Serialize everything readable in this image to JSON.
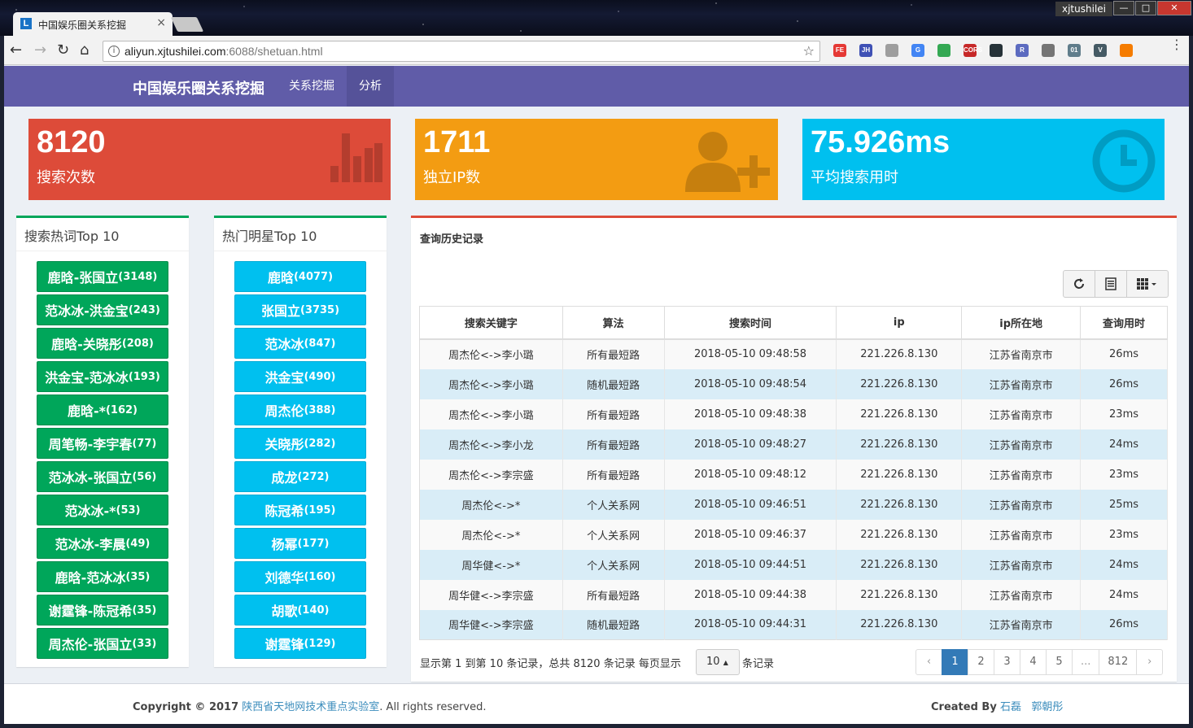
{
  "browser": {
    "tab_title": "中国娱乐圈关系挖掘",
    "tab_favicon": "L",
    "tab_close": "×",
    "url_main": "aliyun.xjtushilei.com",
    "url_rest": ":6088/shetuan.html",
    "window_user": "xjtushilei",
    "extensions": [
      {
        "label": "FE",
        "color": "#e53935"
      },
      {
        "label": "JH",
        "color": "#3f51b5"
      },
      {
        "label": "",
        "color": "#9e9e9e"
      },
      {
        "label": "G",
        "color": "#4285f4"
      },
      {
        "label": "",
        "color": "#34a853"
      },
      {
        "label": "CORS",
        "color": "#c62828"
      },
      {
        "label": "",
        "color": "#263238"
      },
      {
        "label": "R",
        "color": "#5c6bc0"
      },
      {
        "label": "",
        "color": "#757575"
      },
      {
        "label": "01",
        "color": "#607d8b"
      },
      {
        "label": "V",
        "color": "#455a64"
      },
      {
        "label": "",
        "color": "#f57c00"
      }
    ]
  },
  "nav": {
    "brand": "中国娱乐圈关系挖掘",
    "links": [
      "关系挖掘",
      "分析"
    ]
  },
  "stats": [
    {
      "value": "8120",
      "label": "搜索次数",
      "color": "#dd4b39",
      "icon": "bar-chart-icon"
    },
    {
      "value": "1711",
      "label": "独立IP数",
      "color": "#f39c12",
      "icon": "user-plus-icon"
    },
    {
      "value": "75.926ms",
      "label": "平均搜索用时",
      "color": "#00c0ef",
      "icon": "clock-icon"
    }
  ],
  "hot_keywords": {
    "title": "搜索热词Top 10",
    "items": [
      {
        "name": "鹿晗-张国立",
        "count": "(3148)"
      },
      {
        "name": "范冰冰-洪金宝",
        "count": "(243)"
      },
      {
        "name": "鹿晗-关晓彤",
        "count": "(208)"
      },
      {
        "name": "洪金宝-范冰冰",
        "count": "(193)"
      },
      {
        "name": "鹿晗-*",
        "count": "(162)"
      },
      {
        "name": "周笔畅-李宇春",
        "count": "(77)"
      },
      {
        "name": "范冰冰-张国立",
        "count": "(56)"
      },
      {
        "name": "范冰冰-*",
        "count": "(53)"
      },
      {
        "name": "范冰冰-李晨",
        "count": "(49)"
      },
      {
        "name": "鹿晗-范冰冰",
        "count": "(35)"
      },
      {
        "name": "谢霆锋-陈冠希",
        "count": "(35)"
      },
      {
        "name": "周杰伦-张国立",
        "count": "(33)"
      }
    ]
  },
  "hot_stars": {
    "title": "热门明星Top 10",
    "items": [
      {
        "name": "鹿晗",
        "count": "(4077)"
      },
      {
        "name": "张国立",
        "count": "(3735)"
      },
      {
        "name": "范冰冰",
        "count": "(847)"
      },
      {
        "name": "洪金宝",
        "count": "(490)"
      },
      {
        "name": "周杰伦",
        "count": "(388)"
      },
      {
        "name": "关晓彤",
        "count": "(282)"
      },
      {
        "name": "成龙",
        "count": "(272)"
      },
      {
        "name": "陈冠希",
        "count": "(195)"
      },
      {
        "name": "杨幂",
        "count": "(177)"
      },
      {
        "name": "刘德华",
        "count": "(160)"
      },
      {
        "name": "胡歌",
        "count": "(140)"
      },
      {
        "name": "谢霆锋",
        "count": "(129)"
      }
    ]
  },
  "history": {
    "title": "查询历史记录",
    "columns": [
      "搜索关键字",
      "算法",
      "搜索时间",
      "ip",
      "ip所在地",
      "查询用时"
    ],
    "rows": [
      [
        "周杰伦<->李小璐",
        "所有最短路",
        "2018-05-10 09:48:58",
        "221.226.8.130",
        "江苏省南京市",
        "26ms"
      ],
      [
        "周杰伦<->李小璐",
        "随机最短路",
        "2018-05-10 09:48:54",
        "221.226.8.130",
        "江苏省南京市",
        "26ms"
      ],
      [
        "周杰伦<->李小璐",
        "所有最短路",
        "2018-05-10 09:48:38",
        "221.226.8.130",
        "江苏省南京市",
        "23ms"
      ],
      [
        "周杰伦<->李小龙",
        "所有最短路",
        "2018-05-10 09:48:27",
        "221.226.8.130",
        "江苏省南京市",
        "24ms"
      ],
      [
        "周杰伦<->李宗盛",
        "所有最短路",
        "2018-05-10 09:48:12",
        "221.226.8.130",
        "江苏省南京市",
        "23ms"
      ],
      [
        "周杰伦<->*",
        "个人关系网",
        "2018-05-10 09:46:51",
        "221.226.8.130",
        "江苏省南京市",
        "25ms"
      ],
      [
        "周杰伦<->*",
        "个人关系网",
        "2018-05-10 09:46:37",
        "221.226.8.130",
        "江苏省南京市",
        "23ms"
      ],
      [
        "周华健<->*",
        "个人关系网",
        "2018-05-10 09:44:51",
        "221.226.8.130",
        "江苏省南京市",
        "24ms"
      ],
      [
        "周华健<->李宗盛",
        "所有最短路",
        "2018-05-10 09:44:38",
        "221.226.8.130",
        "江苏省南京市",
        "24ms"
      ],
      [
        "周华健<->李宗盛",
        "随机最短路",
        "2018-05-10 09:44:31",
        "221.226.8.130",
        "江苏省南京市",
        "26ms"
      ]
    ],
    "page_info": "显示第 1 到第 10 条记录，总共 8120 条记录 每页显示",
    "page_size": "10",
    "page_info_suffix": "条记录",
    "pages": [
      "‹",
      "1",
      "2",
      "3",
      "4",
      "5",
      "...",
      "812",
      "›"
    ],
    "active_page": "1"
  },
  "footer": {
    "copyright": "Copyright © 2017",
    "org": "陕西省天地网技术重点实验室",
    "rights": ". All rights reserved.",
    "created_by": "Created By",
    "author1": "石磊",
    "author2": "郭朝彤"
  }
}
